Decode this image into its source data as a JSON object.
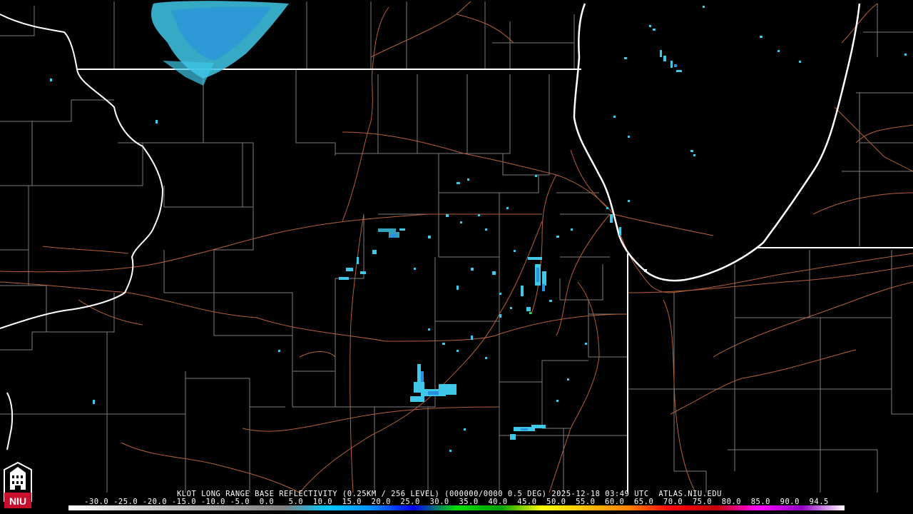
{
  "map": {
    "caption": "KLOT LONG RANGE BASE REFLECTIVITY (0.25KM / 256 LEVEL) (000000/0000 0.5 DEG) 2025-12-18 03:49 UTC  ATLAS.NIU.EDU",
    "scale_ticks": "-30.0 -25.0 -20.0 -15.0 -10.0 -5.0  0.0   5.0  10.0  15.0  20.0  25.0  30.0  35.0  40.0  45.0  50.0  55.0  60.0  65.0  70.0  75.0  80.0  85.0  90.0  94.5",
    "logo_text": "NIU",
    "colors": {
      "background": "#000000",
      "state_borders": "#ffffff",
      "county_lines": "#8a8a8a",
      "roads": "#b5603a",
      "echo_light": "#3fc8e8",
      "echo_mid": "#2a90e0",
      "logo_red": "#c8102e"
    },
    "color_scale_stops": [
      "#ffffff",
      "#e0e0e0",
      "#c8c8c8",
      "#b0b0b0",
      "#989898",
      "#808080",
      "#00c8ff",
      "#0090ff",
      "#0000f0",
      "#00e000",
      "#00a000",
      "#ffff00",
      "#ffc000",
      "#ff8000",
      "#ff0000",
      "#c00000",
      "#ff00ff",
      "#9000c0",
      "#ffffff"
    ]
  }
}
